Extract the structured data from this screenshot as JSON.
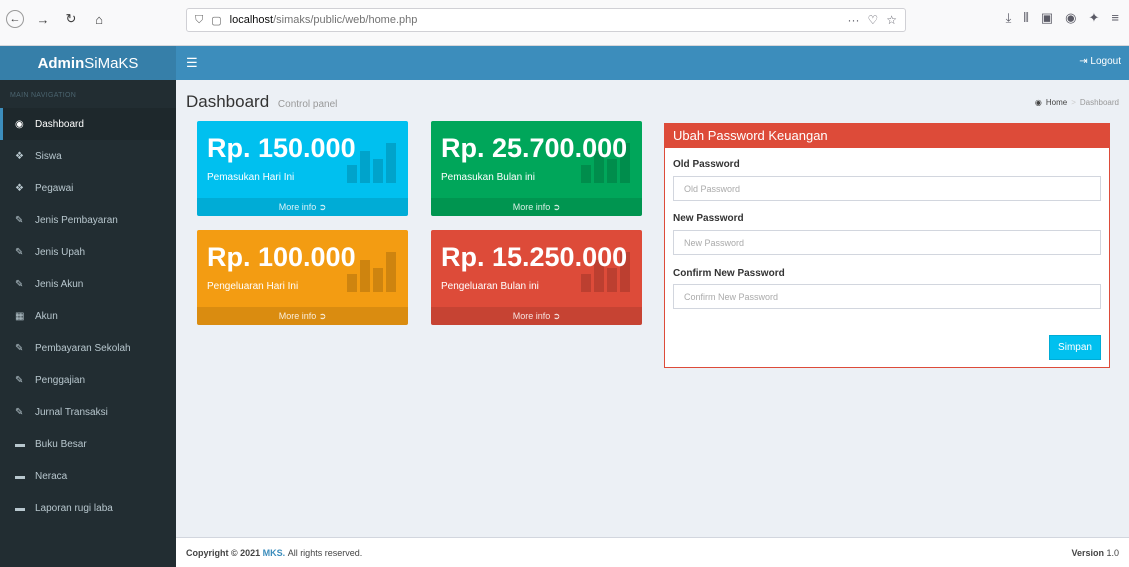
{
  "browser": {
    "url_host": "localhost",
    "url_path": "/simaks/public/web/home.php",
    "url_more": "···",
    "toolbar_icons": [
      "download-icon",
      "library-icon",
      "sidebar-icon",
      "account-icon",
      "extensions-icon",
      "menu-icon"
    ]
  },
  "brand": {
    "bold": "Admin",
    "rest": "SiMaKS"
  },
  "topbar": {
    "logout_label": "Logout"
  },
  "sidebar": {
    "header": "MAIN NAVIGATION",
    "items": [
      {
        "label": "Dashboard",
        "icon": "dashboard-icon",
        "active": true
      },
      {
        "label": "Siswa",
        "icon": "users-icon"
      },
      {
        "label": "Pegawai",
        "icon": "users-icon"
      },
      {
        "label": "Jenis Pembayaran",
        "icon": "edit-icon"
      },
      {
        "label": "Jenis Upah",
        "icon": "edit-icon"
      },
      {
        "label": "Jenis Akun",
        "icon": "edit-icon"
      },
      {
        "label": "Akun",
        "icon": "table-icon"
      },
      {
        "label": "Pembayaran Sekolah",
        "icon": "edit-icon"
      },
      {
        "label": "Penggajian",
        "icon": "edit-icon"
      },
      {
        "label": "Jurnal Transaksi",
        "icon": "edit-icon"
      },
      {
        "label": "Buku Besar",
        "icon": "folder-icon"
      },
      {
        "label": "Neraca",
        "icon": "folder-icon"
      },
      {
        "label": "Laporan rugi laba",
        "icon": "folder-icon"
      }
    ]
  },
  "content": {
    "title": "Dashboard",
    "subtitle": "Control panel",
    "breadcrumb": {
      "home": "Home",
      "current": "Dashboard"
    }
  },
  "boxes": [
    {
      "value": "Rp. 150.000",
      "label": "Pemasukan Hari Ini",
      "more": "More info",
      "color": "#00c0ef"
    },
    {
      "value": "Rp. 25.700.000",
      "label": "Pemasukan Bulan ini",
      "more": "More info",
      "color": "#00a65a"
    },
    {
      "value": "Rp. 100.000",
      "label": "Pengeluaran Hari Ini",
      "more": "More info",
      "color": "#f39c12"
    },
    {
      "value": "Rp. 15.250.000",
      "label": "Pengeluaran Bulan ini",
      "more": "More info",
      "color": "#dd4b39"
    }
  ],
  "password_form": {
    "title": "Ubah Password Keuangan",
    "old_label": "Old Password",
    "old_placeholder": "Old Password",
    "new_label": "New Password",
    "new_placeholder": "New Password",
    "confirm_label": "Confirm New Password",
    "confirm_placeholder": "Confirm New Password",
    "submit_label": "Simpan"
  },
  "footer": {
    "copyright_prefix": "Copyright © 2021",
    "brand": "MKS.",
    "rest": "All rights reserved.",
    "version_label": "Version",
    "version_value": "1.0"
  },
  "colors": {
    "primary": "#3c8dbc",
    "sidebar": "#222d32",
    "danger": "#dd4b39",
    "info": "#00c0ef"
  }
}
